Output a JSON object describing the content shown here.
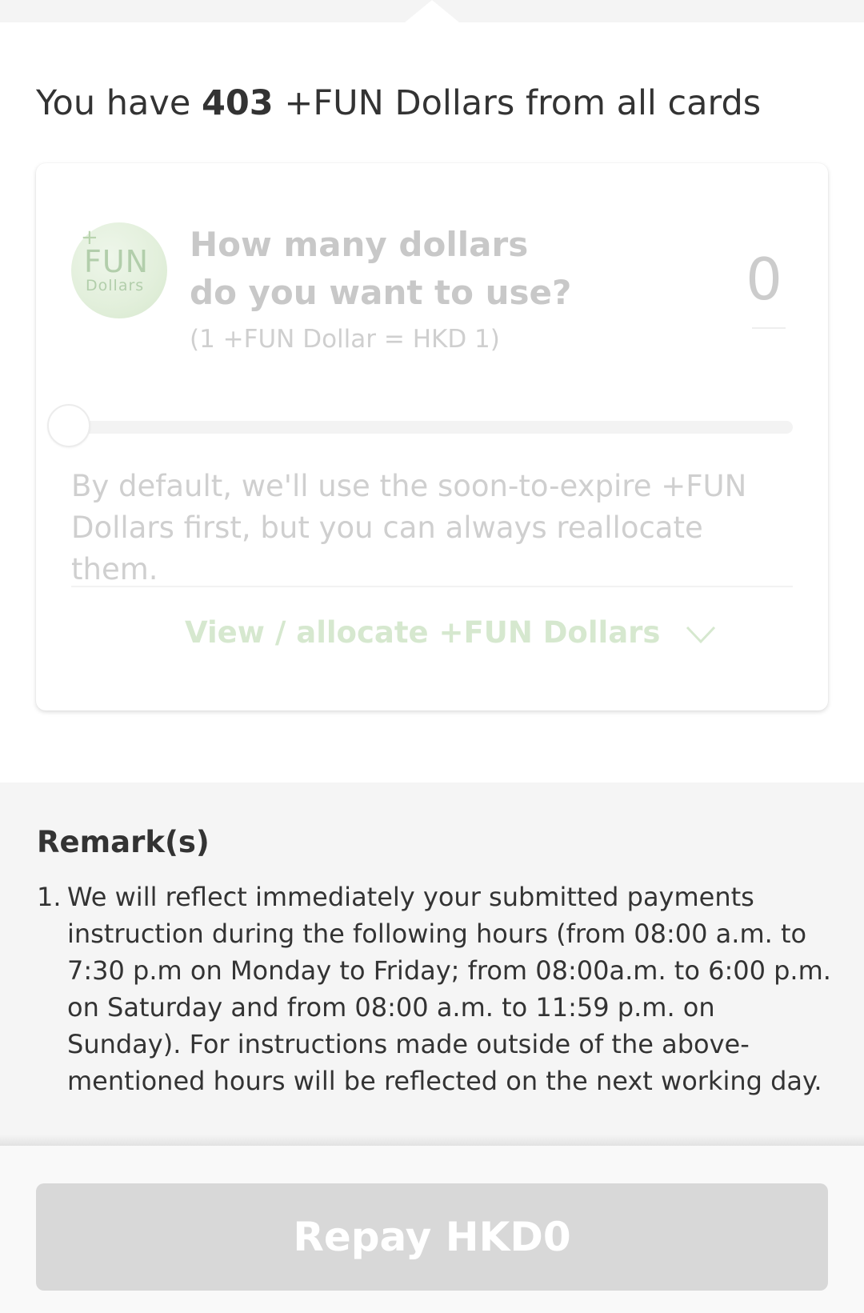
{
  "summary": {
    "prefix": "You have ",
    "count": "403",
    "suffix": " +FUN Dollars from all cards"
  },
  "card": {
    "logo": {
      "plus": "+",
      "fun": "FUN",
      "dollars": "Dollars"
    },
    "question_line1": "How many dollars",
    "question_line2": "do you want to use?",
    "rate": "(1 +FUN Dollar = HKD 1)",
    "amount_value": "0",
    "slider_value": 0,
    "note": "By default, we'll use the soon-to-expire +FUN Dollars first, but you can always reallocate them.",
    "view_link": "View / allocate +FUN Dollars",
    "view_link_icon": "chevron-down-icon"
  },
  "remarks": {
    "title": "Remark(s)",
    "items": [
      {
        "number": "1.",
        "text": "We will reflect immediately your submitted payments instruction during the following hours (from 08:00 a.m. to 7:30 p.m on Monday to Friday; from 08:00a.m. to 6:00 p.m. on Saturday and from 08:00 a.m. to 11:59 p.m. on Sunday). For instructions made outside of the above-mentioned hours will be reflected on the next working day."
      }
    ]
  },
  "footer": {
    "repay_button": "Repay HKD0"
  },
  "colors": {
    "disabled_button": "#d8d8d8",
    "fun_green": "#d6e8cf",
    "remarks_background": "#f5f5f5"
  }
}
